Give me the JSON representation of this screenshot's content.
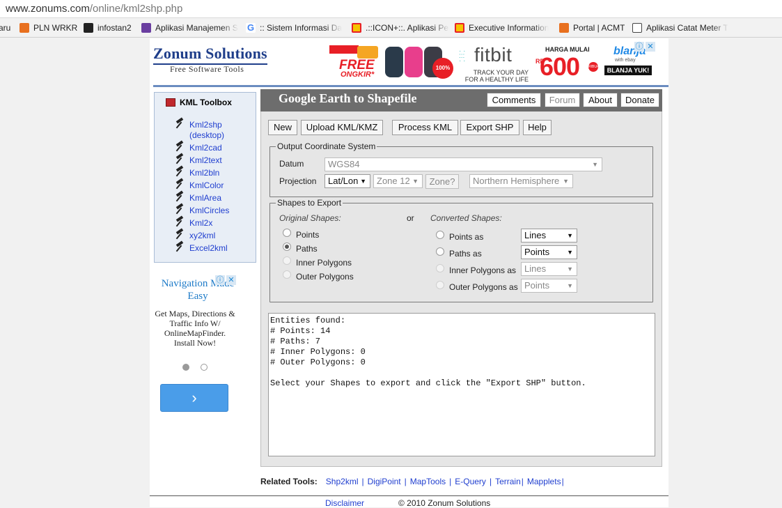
{
  "browser": {
    "url_host": "www.zonums.com",
    "url_path": "/online/kml2shp.php",
    "bookmarks": [
      {
        "label": "aru",
        "color": "#ffffff"
      },
      {
        "label": "PLN WRKR",
        "color": "#e8701f"
      },
      {
        "label": "infostan2",
        "color": "#222222"
      },
      {
        "label": "Aplikasi Manajemen S",
        "color": "#6a3ea0"
      },
      {
        "label": ":: Sistem Informasi Da",
        "color": "#4285f4"
      },
      {
        "label": ".::ICON+::. Aplikasi Pel",
        "color": "#e81f26"
      },
      {
        "label": "Executive Information",
        "color": "#e81f26"
      },
      {
        "label": "Portal | ACMT",
        "color": "#e8701f"
      },
      {
        "label": "Aplikasi Catat Meter T",
        "color": "#444444"
      }
    ]
  },
  "site": {
    "logo_title": "Zonum Solutions",
    "logo_sub": "Free Software Tools"
  },
  "banner_ad": {
    "free": "FREE",
    "ongkir": "ONGKIR*",
    "badge": "100% ORIGINAL",
    "fitbit": "fitbit",
    "fitbit_sub": "TRACK YOUR DAY FOR A HEALTHY LIFE",
    "harga": "HARGA MULAI",
    "rp": "RP",
    "price": "600",
    "ribuan": "RIBUAN",
    "blanja": "blanja",
    "ebay": "with ebay",
    "blanja_btn": "BLANJA YUK!"
  },
  "toolbox": {
    "title": "KML Toolbox",
    "items": [
      "Kml2shp (desktop)",
      "Kml2cad",
      "Kml2text",
      "Kml2bln",
      "KmlColor",
      "KmlArea",
      "KmlCircles",
      "Kml2x",
      "xy2kml",
      "Excel2kml"
    ]
  },
  "side_ad": {
    "headline": "Navigation Made Easy",
    "body": "Get Maps, Directions & Traffic Info W/ OnlineMapFinder. Install Now!",
    "go": "›"
  },
  "app": {
    "title": "Google Earth to Shapefile",
    "top_buttons": [
      "Comments",
      "Forum",
      "About",
      "Donate"
    ],
    "actions": [
      "New",
      "Upload KML/KMZ",
      "Process KML",
      "Export SHP",
      "Help"
    ],
    "ocs": {
      "legend": "Output Coordinate System",
      "datum_label": "Datum",
      "datum_value": "WGS84",
      "projection_label": "Projection",
      "projection_value": "Lat/Lon",
      "zone_value": "Zone 12",
      "zone_btn": "Zone?",
      "hemisphere_value": "Northern Hemisphere"
    },
    "shapes": {
      "legend": "Shapes to Export",
      "original_label": "Original Shapes:",
      "or": "or",
      "converted_label": "Converted Shapes:",
      "original": [
        "Points",
        "Paths",
        "Inner Polygons",
        "Outer Polygons"
      ],
      "original_selected": 1,
      "converted": [
        {
          "label": "Points as",
          "value": "Lines"
        },
        {
          "label": "Paths as",
          "value": "Points"
        },
        {
          "label": "Inner Polygons as",
          "value": "Lines"
        },
        {
          "label": "Outer Polygons as",
          "value": "Points"
        }
      ]
    },
    "output_text": "Entities found:\n# Points: 14\n# Paths: 7\n# Inner Polygons: 0\n# Outer Polygons: 0\n\nSelect your Shapes to export and click the \"Export SHP\" button."
  },
  "footer": {
    "related_label": "Related Tools:",
    "related": [
      "Shp2kml",
      "DigiPoint",
      "MapTools",
      "E-Query",
      "Terrain",
      "Mapplets"
    ],
    "disclaimer": "Disclaimer",
    "copyright": "© 2010 Zonum Solutions"
  }
}
